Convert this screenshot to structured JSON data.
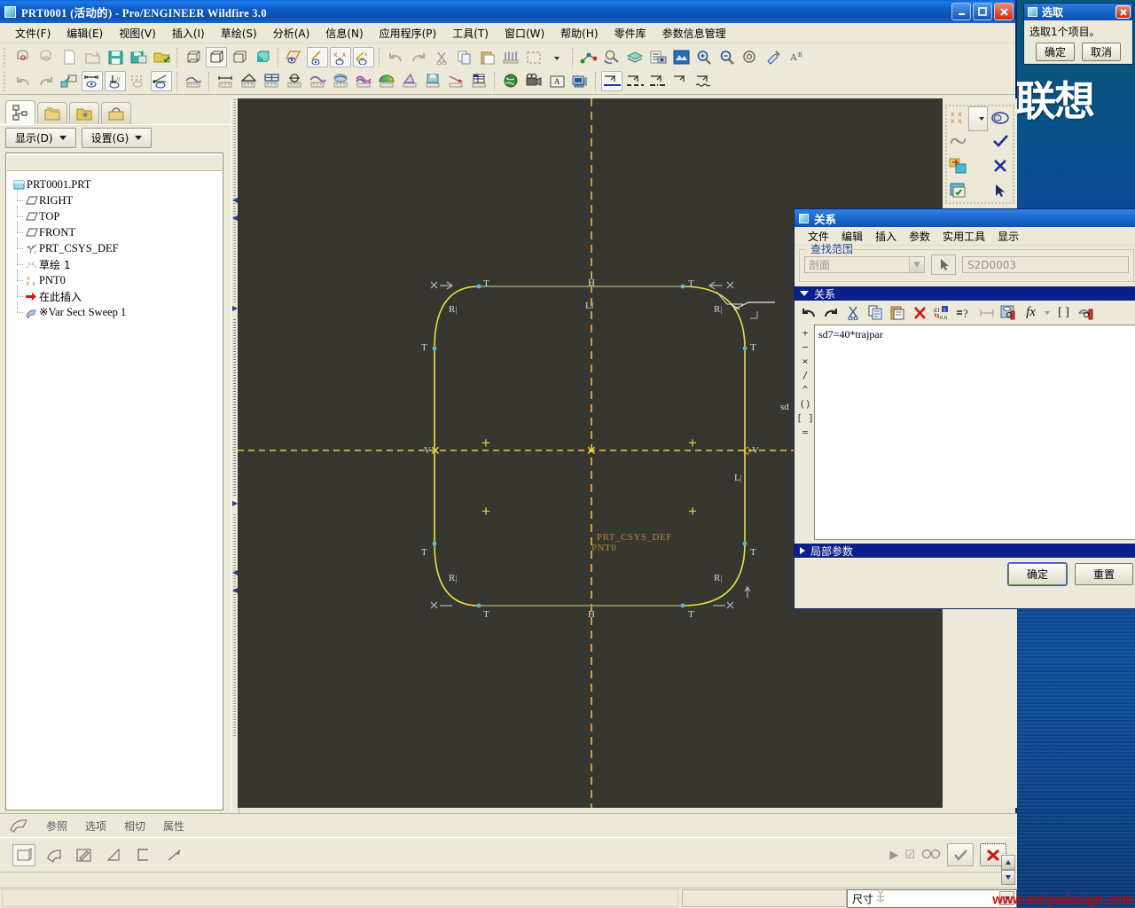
{
  "window": {
    "title": "PRT0001 (活动的) - Pro/ENGINEER Wildfire 3.0",
    "minimize": "_",
    "maximize": "❐",
    "close": "✕"
  },
  "menubar": {
    "items": [
      "文件(F)",
      "编辑(E)",
      "视图(V)",
      "插入(I)",
      "草绘(S)",
      "分析(A)",
      "信息(N)",
      "应用程序(P)",
      "工具(T)",
      "窗口(W)",
      "帮助(H)",
      "零件库",
      "参数信息管理"
    ]
  },
  "navigator": {
    "tabs": [
      {
        "name": "model-tree-tab",
        "icon": "model-tree-icon"
      },
      {
        "name": "folder-browser-tab",
        "icon": "folders-icon"
      },
      {
        "name": "favorites-tab",
        "icon": "favorites-folder-icon"
      },
      {
        "name": "connections-tab",
        "icon": "toolbox-icon"
      }
    ],
    "buttons": [
      {
        "label": "显示(D)",
        "name": "show-menu-button"
      },
      {
        "label": "设置(G)",
        "name": "settings-menu-button"
      }
    ],
    "tree": [
      {
        "label": "PRT0001.PRT",
        "icon": "part-icon",
        "level": 0
      },
      {
        "label": "RIGHT",
        "icon": "datum-plane-icon",
        "level": 1
      },
      {
        "label": "TOP",
        "icon": "datum-plane-icon",
        "level": 1
      },
      {
        "label": "FRONT",
        "icon": "datum-plane-icon",
        "level": 1
      },
      {
        "label": "PRT_CSYS_DEF",
        "icon": "coordinate-system-icon",
        "level": 1
      },
      {
        "label": "草绘 1",
        "icon": "sketch-icon",
        "level": 1
      },
      {
        "label": "PNT0",
        "icon": "datum-point-icon",
        "level": 1
      },
      {
        "label": "在此插入",
        "icon": "insert-here-arrow-icon",
        "level": 1
      },
      {
        "label": "※Var Sect Sweep 1",
        "icon": "sweep-feature-icon",
        "level": 1
      }
    ]
  },
  "graphics": {
    "sketch_labels": {
      "csys": "PRT_CSYS_DEF",
      "point": "PNT0",
      "dimension_partial": "sd"
    },
    "constraints": {
      "tangent": "T",
      "radius": "R",
      "horizontal": "H",
      "vertical": "V",
      "equal_length": "L"
    },
    "side_tools": [
      {
        "name": "datum-points-display-button",
        "icon": "datum-points-icon"
      },
      {
        "name": "sketch-shade-button",
        "icon": "shaded-closed-loop-icon"
      },
      {
        "name": "chain-link-button",
        "icon": "chain-link-icon"
      },
      {
        "name": "accept-check-button",
        "icon": "check-icon"
      },
      {
        "name": "section-toggle-button",
        "icon": "section-swap-icon"
      },
      {
        "name": "cancel-x-button",
        "icon": "x-icon"
      },
      {
        "name": "sketch-view-button",
        "icon": "window-check-icon"
      },
      {
        "name": "select-arrow-button",
        "icon": "cursor-arrow-icon"
      }
    ]
  },
  "select_dialog": {
    "title": "选取",
    "close": "✕",
    "message": "选取1个项目。",
    "ok": "确定",
    "cancel": "取消"
  },
  "relations_dialog": {
    "title": "关系",
    "menu": [
      "文件",
      "编辑",
      "插入",
      "参数",
      "实用工具",
      "显示"
    ],
    "lookin_legend": "查找范围",
    "scope_value": "剖面",
    "name_value": "S2D0003",
    "relations_section": "关系",
    "local_params_section": "局部参数",
    "operators": [
      "+",
      "−",
      "×",
      "/",
      "^",
      "()",
      "[ ]",
      "="
    ],
    "relation_text": "sd7=40*trajpar",
    "toolbar": [
      {
        "name": "undo-button",
        "icon": "undo-icon"
      },
      {
        "name": "redo-button",
        "icon": "redo-icon"
      },
      {
        "name": "cut-button",
        "icon": "scissors-icon"
      },
      {
        "name": "copy-button",
        "icon": "copy-icon"
      },
      {
        "name": "paste-button",
        "icon": "paste-icon"
      },
      {
        "name": "delete-button",
        "icon": "red-x-icon"
      },
      {
        "name": "switch-dim-button",
        "icon": "switch-dimensions-icon"
      },
      {
        "name": "verify-button",
        "icon": "equals-question-icon"
      },
      {
        "name": "dimension-button",
        "icon": "dimension-arrows-icon"
      },
      {
        "name": "insert-from-list-button",
        "icon": "insert-list-icon"
      },
      {
        "name": "function-button",
        "icon": "fx-icon"
      },
      {
        "name": "brackets-button",
        "icon": "brackets-icon"
      },
      {
        "name": "units-button",
        "icon": "units-icon"
      }
    ],
    "ok": "确定",
    "reset": "重置"
  },
  "dashboard": {
    "tabs": [
      "参照",
      "选项",
      "相切",
      "属性"
    ],
    "tools": [
      {
        "name": "surface-button",
        "icon": "surface-icon"
      },
      {
        "name": "thicken-button",
        "icon": "thicken-icon"
      },
      {
        "name": "sketch-edit-button",
        "icon": "sketch-pencil-icon"
      },
      {
        "name": "remove-material-button",
        "icon": "remove-material-icon"
      },
      {
        "name": "thin-feature-button",
        "icon": "thin-feature-icon"
      },
      {
        "name": "section-flip-button",
        "icon": "flip-direction-icon"
      }
    ],
    "play_button": "▶",
    "preview_checkbox": "☑",
    "glasses_button": "glasses-icon",
    "accept_button": "✔",
    "cancel_button": "✖"
  },
  "statusbar": {
    "filter_value": "尺寸",
    "watermark": "www.meiyadesign.com"
  },
  "desktop": {
    "logo_text": "联想"
  },
  "colors": {
    "title_blue": "#0b5bc4",
    "window_face": "#ece9d8",
    "graphics_bg": "#383631",
    "sketch_yellow": "#e8e03a",
    "centerline_gold": "#c8a13a",
    "section_blue": "#0a1f8c",
    "watermark_red": "#d00000"
  }
}
